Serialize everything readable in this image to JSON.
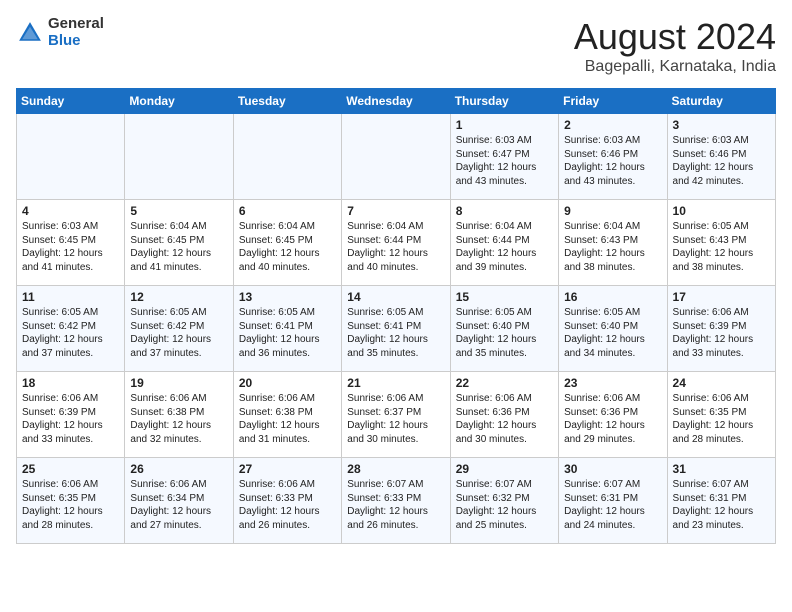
{
  "logo": {
    "general": "General",
    "blue": "Blue"
  },
  "title": "August 2024",
  "location": "Bagepalli, Karnataka, India",
  "headers": [
    "Sunday",
    "Monday",
    "Tuesday",
    "Wednesday",
    "Thursday",
    "Friday",
    "Saturday"
  ],
  "weeks": [
    [
      {
        "day": "",
        "info": ""
      },
      {
        "day": "",
        "info": ""
      },
      {
        "day": "",
        "info": ""
      },
      {
        "day": "",
        "info": ""
      },
      {
        "day": "1",
        "info": "Sunrise: 6:03 AM\nSunset: 6:47 PM\nDaylight: 12 hours\nand 43 minutes."
      },
      {
        "day": "2",
        "info": "Sunrise: 6:03 AM\nSunset: 6:46 PM\nDaylight: 12 hours\nand 43 minutes."
      },
      {
        "day": "3",
        "info": "Sunrise: 6:03 AM\nSunset: 6:46 PM\nDaylight: 12 hours\nand 42 minutes."
      }
    ],
    [
      {
        "day": "4",
        "info": "Sunrise: 6:03 AM\nSunset: 6:45 PM\nDaylight: 12 hours\nand 41 minutes."
      },
      {
        "day": "5",
        "info": "Sunrise: 6:04 AM\nSunset: 6:45 PM\nDaylight: 12 hours\nand 41 minutes."
      },
      {
        "day": "6",
        "info": "Sunrise: 6:04 AM\nSunset: 6:45 PM\nDaylight: 12 hours\nand 40 minutes."
      },
      {
        "day": "7",
        "info": "Sunrise: 6:04 AM\nSunset: 6:44 PM\nDaylight: 12 hours\nand 40 minutes."
      },
      {
        "day": "8",
        "info": "Sunrise: 6:04 AM\nSunset: 6:44 PM\nDaylight: 12 hours\nand 39 minutes."
      },
      {
        "day": "9",
        "info": "Sunrise: 6:04 AM\nSunset: 6:43 PM\nDaylight: 12 hours\nand 38 minutes."
      },
      {
        "day": "10",
        "info": "Sunrise: 6:05 AM\nSunset: 6:43 PM\nDaylight: 12 hours\nand 38 minutes."
      }
    ],
    [
      {
        "day": "11",
        "info": "Sunrise: 6:05 AM\nSunset: 6:42 PM\nDaylight: 12 hours\nand 37 minutes."
      },
      {
        "day": "12",
        "info": "Sunrise: 6:05 AM\nSunset: 6:42 PM\nDaylight: 12 hours\nand 37 minutes."
      },
      {
        "day": "13",
        "info": "Sunrise: 6:05 AM\nSunset: 6:41 PM\nDaylight: 12 hours\nand 36 minutes."
      },
      {
        "day": "14",
        "info": "Sunrise: 6:05 AM\nSunset: 6:41 PM\nDaylight: 12 hours\nand 35 minutes."
      },
      {
        "day": "15",
        "info": "Sunrise: 6:05 AM\nSunset: 6:40 PM\nDaylight: 12 hours\nand 35 minutes."
      },
      {
        "day": "16",
        "info": "Sunrise: 6:05 AM\nSunset: 6:40 PM\nDaylight: 12 hours\nand 34 minutes."
      },
      {
        "day": "17",
        "info": "Sunrise: 6:06 AM\nSunset: 6:39 PM\nDaylight: 12 hours\nand 33 minutes."
      }
    ],
    [
      {
        "day": "18",
        "info": "Sunrise: 6:06 AM\nSunset: 6:39 PM\nDaylight: 12 hours\nand 33 minutes."
      },
      {
        "day": "19",
        "info": "Sunrise: 6:06 AM\nSunset: 6:38 PM\nDaylight: 12 hours\nand 32 minutes."
      },
      {
        "day": "20",
        "info": "Sunrise: 6:06 AM\nSunset: 6:38 PM\nDaylight: 12 hours\nand 31 minutes."
      },
      {
        "day": "21",
        "info": "Sunrise: 6:06 AM\nSunset: 6:37 PM\nDaylight: 12 hours\nand 30 minutes."
      },
      {
        "day": "22",
        "info": "Sunrise: 6:06 AM\nSunset: 6:36 PM\nDaylight: 12 hours\nand 30 minutes."
      },
      {
        "day": "23",
        "info": "Sunrise: 6:06 AM\nSunset: 6:36 PM\nDaylight: 12 hours\nand 29 minutes."
      },
      {
        "day": "24",
        "info": "Sunrise: 6:06 AM\nSunset: 6:35 PM\nDaylight: 12 hours\nand 28 minutes."
      }
    ],
    [
      {
        "day": "25",
        "info": "Sunrise: 6:06 AM\nSunset: 6:35 PM\nDaylight: 12 hours\nand 28 minutes."
      },
      {
        "day": "26",
        "info": "Sunrise: 6:06 AM\nSunset: 6:34 PM\nDaylight: 12 hours\nand 27 minutes."
      },
      {
        "day": "27",
        "info": "Sunrise: 6:06 AM\nSunset: 6:33 PM\nDaylight: 12 hours\nand 26 minutes."
      },
      {
        "day": "28",
        "info": "Sunrise: 6:07 AM\nSunset: 6:33 PM\nDaylight: 12 hours\nand 26 minutes."
      },
      {
        "day": "29",
        "info": "Sunrise: 6:07 AM\nSunset: 6:32 PM\nDaylight: 12 hours\nand 25 minutes."
      },
      {
        "day": "30",
        "info": "Sunrise: 6:07 AM\nSunset: 6:31 PM\nDaylight: 12 hours\nand 24 minutes."
      },
      {
        "day": "31",
        "info": "Sunrise: 6:07 AM\nSunset: 6:31 PM\nDaylight: 12 hours\nand 23 minutes."
      }
    ]
  ]
}
